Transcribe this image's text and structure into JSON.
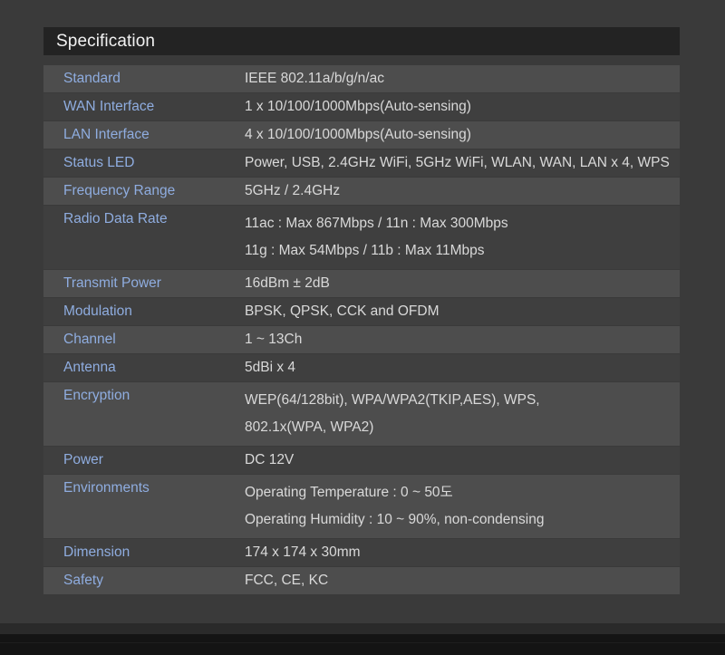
{
  "page": {
    "background_color": "#3a3a3a",
    "header_background_color": "#232323",
    "row_color_dark": "#3f3f3f",
    "row_color_light": "#4d4d4d",
    "label_color": "#8fade0",
    "value_color": "#d9d9d9",
    "title_color": "#f2f2f2"
  },
  "spec": {
    "title": "Specification",
    "rows": [
      {
        "label": "Standard",
        "lines": [
          "IEEE 802.11a/b/g/n/ac"
        ]
      },
      {
        "label": "WAN Interface",
        "lines": [
          "1 x 10/100/1000Mbps(Auto-sensing)"
        ]
      },
      {
        "label": "LAN Interface",
        "lines": [
          "4 x 10/100/1000Mbps(Auto-sensing)"
        ]
      },
      {
        "label": "Status LED",
        "lines": [
          "Power, USB, 2.4GHz WiFi, 5GHz WiFi, WLAN, WAN, LAN x 4, WPS"
        ]
      },
      {
        "label": "Frequency Range",
        "lines": [
          "5GHz / 2.4GHz"
        ]
      },
      {
        "label": "Radio Data Rate",
        "lines": [
          "11ac : Max 867Mbps / 11n : Max 300Mbps",
          "11g : Max 54Mbps / 11b : Max 11Mbps"
        ]
      },
      {
        "label": "Transmit Power",
        "lines": [
          "16dBm ± 2dB"
        ]
      },
      {
        "label": "Modulation",
        "lines": [
          "BPSK, QPSK, CCK and OFDM"
        ]
      },
      {
        "label": "Channel",
        "lines": [
          "1 ~ 13Ch"
        ]
      },
      {
        "label": "Antenna",
        "lines": [
          "5dBi x 4"
        ]
      },
      {
        "label": "Encryption",
        "lines": [
          "WEP(64/128bit), WPA/WPA2(TKIP,AES), WPS,",
          "802.1x(WPA, WPA2)"
        ]
      },
      {
        "label": "Power",
        "lines": [
          "DC 12V"
        ]
      },
      {
        "label": "Environments",
        "lines": [
          "Operating Temperature : 0 ~ 50도",
          "Operating Humidity : 10 ~ 90%, non-condensing"
        ]
      },
      {
        "label": "Dimension",
        "lines": [
          "174 x 174 x 30mm"
        ]
      },
      {
        "label": "Safety",
        "lines": [
          "FCC, CE, KC"
        ]
      }
    ]
  }
}
